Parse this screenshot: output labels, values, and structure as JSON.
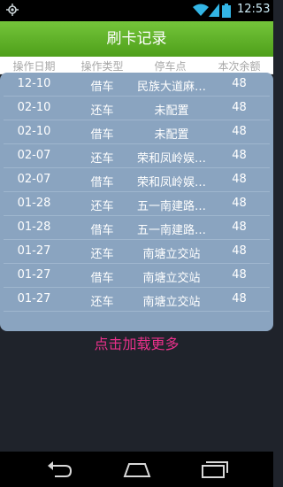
{
  "status": {
    "time": "12:53"
  },
  "title": "刷卡记录",
  "headers": [
    "操作日期",
    "操作类型",
    "停车点",
    "本次余额"
  ],
  "rows": [
    [
      "12-10",
      "借车",
      "民族大道麻…",
      "48"
    ],
    [
      "02-10",
      "还车",
      "未配置",
      "48"
    ],
    [
      "02-10",
      "借车",
      "未配置",
      "48"
    ],
    [
      "02-07",
      "还车",
      "荣和凤岭娱…",
      "48"
    ],
    [
      "02-07",
      "借车",
      "荣和凤岭娱…",
      "48"
    ],
    [
      "01-28",
      "还车",
      "五一南建路…",
      "48"
    ],
    [
      "01-28",
      "借车",
      "五一南建路…",
      "48"
    ],
    [
      "01-27",
      "还车",
      "南塘立交站",
      "48"
    ],
    [
      "01-27",
      "借车",
      "南塘立交站",
      "48"
    ],
    [
      "01-27",
      "还车",
      "南塘立交站",
      "48"
    ]
  ],
  "load_more": "点击加载更多",
  "colors": {
    "title_bar": "#5fb22a",
    "panel": "#8aa4c0",
    "load_more": "#e8308a"
  }
}
